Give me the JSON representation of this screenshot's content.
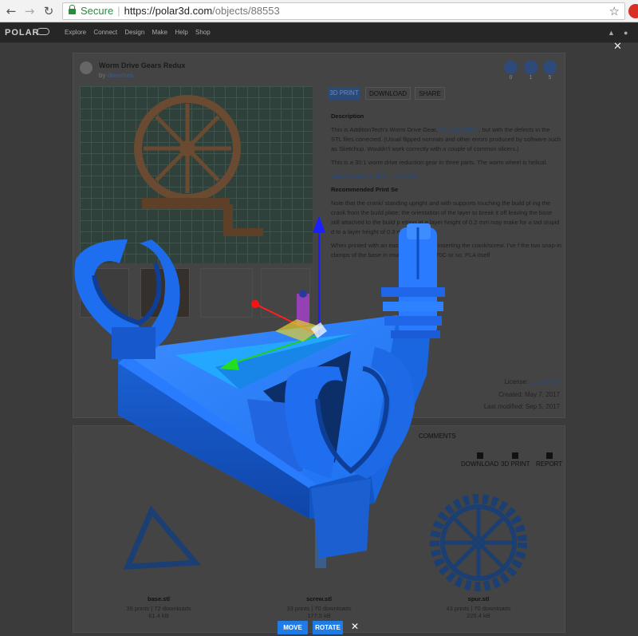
{
  "browser": {
    "secure_label": "Secure",
    "url_host": "https://polar3d.com",
    "url_path": "/objects/88553"
  },
  "site_header": {
    "logo": "POLAR",
    "menu": [
      "Explore",
      "Connect",
      "Design",
      "Make",
      "Help",
      "Shop"
    ]
  },
  "object": {
    "title": "Worm Drive Gears Redux",
    "by_prefix": "by",
    "author": "drewmes",
    "stats": [
      "0",
      "1",
      "5"
    ],
    "tabs": {
      "print": "3D PRINT",
      "download": "DOWNLOAD",
      "share": "SHARE"
    },
    "description_heading": "Description",
    "description_p1_a": "This is AdditionTech's Worm Drive Gear,",
    "description_p1_link": "Thing 2144347",
    "description_p1_b": ", but with the defects in the STL files corrected. (Usual flipped normals and other errors produced by software such as Sketchup. Wouldn't work correctly with a couple of common slicers.)",
    "description_p2": "This is a 30:1 worm drive reduction gear in three parts. The worm wheel is helical.",
    "video_link": "https://youtu.be/VE7kmcewCOQ",
    "settings_heading": "Recommended Print Se",
    "settings_p1": "Note that the crank/           standing upright and with supports touching the build pl           ing the crank from the build plate; the orientation of the layer          to break it off leaving the base still attached to the build p          etting at a layer height of 0.2 mm may make for a tad stupid          d to a layer height of 0.3 mm.",
    "settings_p2": "When printed with          an easily crack when inserting the crank/screw. I've f          the two snap-in clamps of the base in               much hotter than 70C or so. PLA itself",
    "license_label": "License:",
    "license": "CC-BY-SA",
    "created": "Created: May 7, 2017",
    "modified": "Last modified: Sep 5, 2017"
  },
  "files_section": {
    "comments_tab": "COMMENTS",
    "actions": [
      "DOWNLOAD",
      "3D PRINT",
      "REPORT"
    ],
    "files": [
      {
        "name": "base.stl",
        "stats": "39 prints | 72 downloads",
        "size": "61.4 kB"
      },
      {
        "name": "screw.stl",
        "stats": "33 prints | 70 downloads",
        "size": "177.5 kB"
      },
      {
        "name": "spur.stl",
        "stats": "43 prints | 70 downloads",
        "size": "225.4 kB"
      }
    ]
  },
  "viewer_controls": {
    "move": "MOVE",
    "rotate": "ROTATE"
  },
  "colors": {
    "model_blue": "#1a6ff0",
    "accent_button": "#1f7be6",
    "secure_green": "#2b8a3e"
  }
}
